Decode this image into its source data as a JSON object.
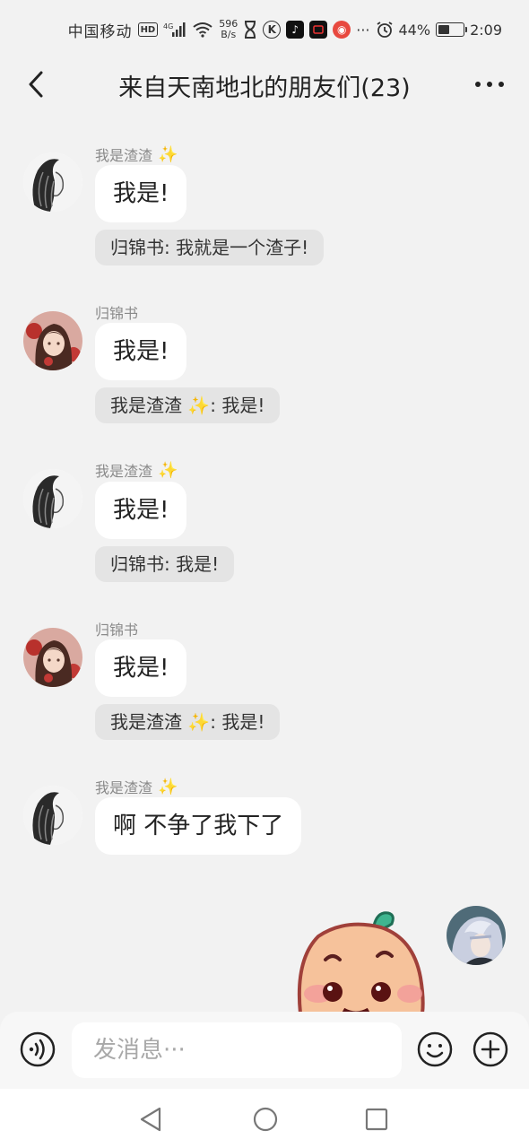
{
  "status_bar": {
    "carrier": "中国移动",
    "hd": "HD",
    "network": "4G",
    "speed_value": "596",
    "speed_unit": "B/s",
    "battery": "44%",
    "time": "2:09"
  },
  "header": {
    "title": "来自天南地北的朋友们(23)"
  },
  "messages": [
    {
      "sender": "我是渣渣",
      "sender_sparkle": true,
      "text": "我是!",
      "quote": {
        "prefix": "归锦书: ",
        "text": "我就是一个渣子!"
      }
    },
    {
      "sender": "归锦书",
      "sender_sparkle": false,
      "text": "我是!",
      "quote": {
        "prefix": "我是渣渣",
        "sparkle": true,
        "text": ": 我是!"
      }
    },
    {
      "sender": "我是渣渣",
      "sender_sparkle": true,
      "text": "我是!",
      "quote": {
        "prefix": "归锦书: ",
        "text": "我是!"
      }
    },
    {
      "sender": "归锦书",
      "sender_sparkle": false,
      "text": "我是!",
      "quote": {
        "prefix": "我是渣渣",
        "sparkle": true,
        "text": ": 我是!"
      }
    },
    {
      "sender": "我是渣渣",
      "sender_sparkle": true,
      "text": "啊 不争了我下了"
    }
  ],
  "input": {
    "placeholder": "发消息···"
  },
  "icons": {
    "back": "back-arrow-icon",
    "more": "more-dots-icon",
    "voice": "voice-icon",
    "emoji": "emoji-icon",
    "plus": "plus-icon"
  },
  "colors": {
    "background": "#f2f2f2",
    "bubble": "#ffffff",
    "quote": "#e4e4e4",
    "sparkle": "#f2c43a"
  }
}
